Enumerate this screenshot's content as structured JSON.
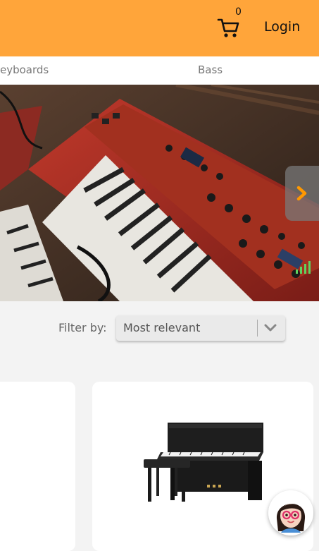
{
  "header": {
    "cart_count": "0",
    "login_label": "Login"
  },
  "nav": {
    "items": [
      {
        "label": "eyboards"
      },
      {
        "label": "Bass"
      }
    ]
  },
  "filter": {
    "label": "Filter by:",
    "selected": "Most relevant"
  },
  "colors": {
    "header_bg": "#ffa53a",
    "accent": "#ff9800"
  },
  "icons": {
    "cart": "cart-icon",
    "next": "chevron-right-icon",
    "dropdown": "chevron-down-icon"
  }
}
